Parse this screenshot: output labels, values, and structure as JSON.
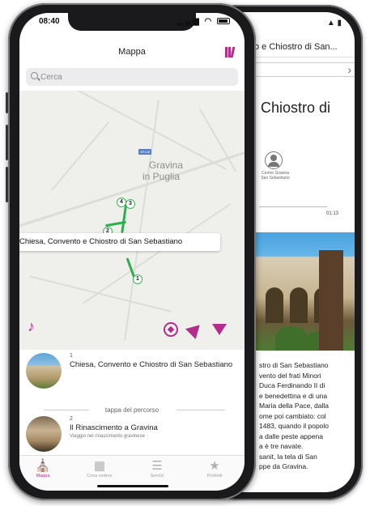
{
  "back_screen": {
    "header_title": "o e Chiostro di San...",
    "heading": "Chiostro di",
    "author_caption": "Centro Gravina San Sebastiano",
    "duration": "01:13",
    "body_lines": [
      "stro di San Sebastiano",
      "vento del frati Minori",
      "Duca Ferdinando II di",
      "e benedettina e di una",
      "Maria della Pace, dalla",
      "ome poi cambiato: col",
      "1483, quando il popolo",
      "a dalle peste appena",
      "a è tre navate.",
      "sanit, la tela di San",
      "ppe da Gravina."
    ]
  },
  "status_bar": {
    "time": "08:40"
  },
  "nav": {
    "title": "Mappa"
  },
  "search": {
    "placeholder": "Cerca"
  },
  "map": {
    "town_label_1": "Gravina",
    "town_label_2": "in Puglia",
    "area_tag": "SP148",
    "markers": [
      "4",
      "3",
      "2",
      "1"
    ],
    "callout": "Chiesa, Convento e Chiostro di San Sebastiano"
  },
  "list": {
    "stops": [
      {
        "number": "1",
        "title": "Chiesa, Convento e Chiostro di San Sebastiano",
        "subtitle": ""
      },
      {
        "number": "2",
        "title": "Il Rinascimento a Gravina",
        "subtitle": "Viaggio nel rinascimento gravinese"
      }
    ],
    "separator": "tappa del percorso"
  },
  "tabs": [
    {
      "label": "Mappa",
      "icon": "church-icon",
      "active": true
    },
    {
      "label": "Cosa vedere",
      "icon": "grid-icon",
      "active": false
    },
    {
      "label": "Servizi",
      "icon": "list-icon",
      "active": false
    },
    {
      "label": "Preferiti",
      "icon": "star-icon",
      "active": false
    }
  ],
  "colors": {
    "accent": "#b42c8c",
    "route": "#2fae4e",
    "map_background": "#efefec"
  }
}
